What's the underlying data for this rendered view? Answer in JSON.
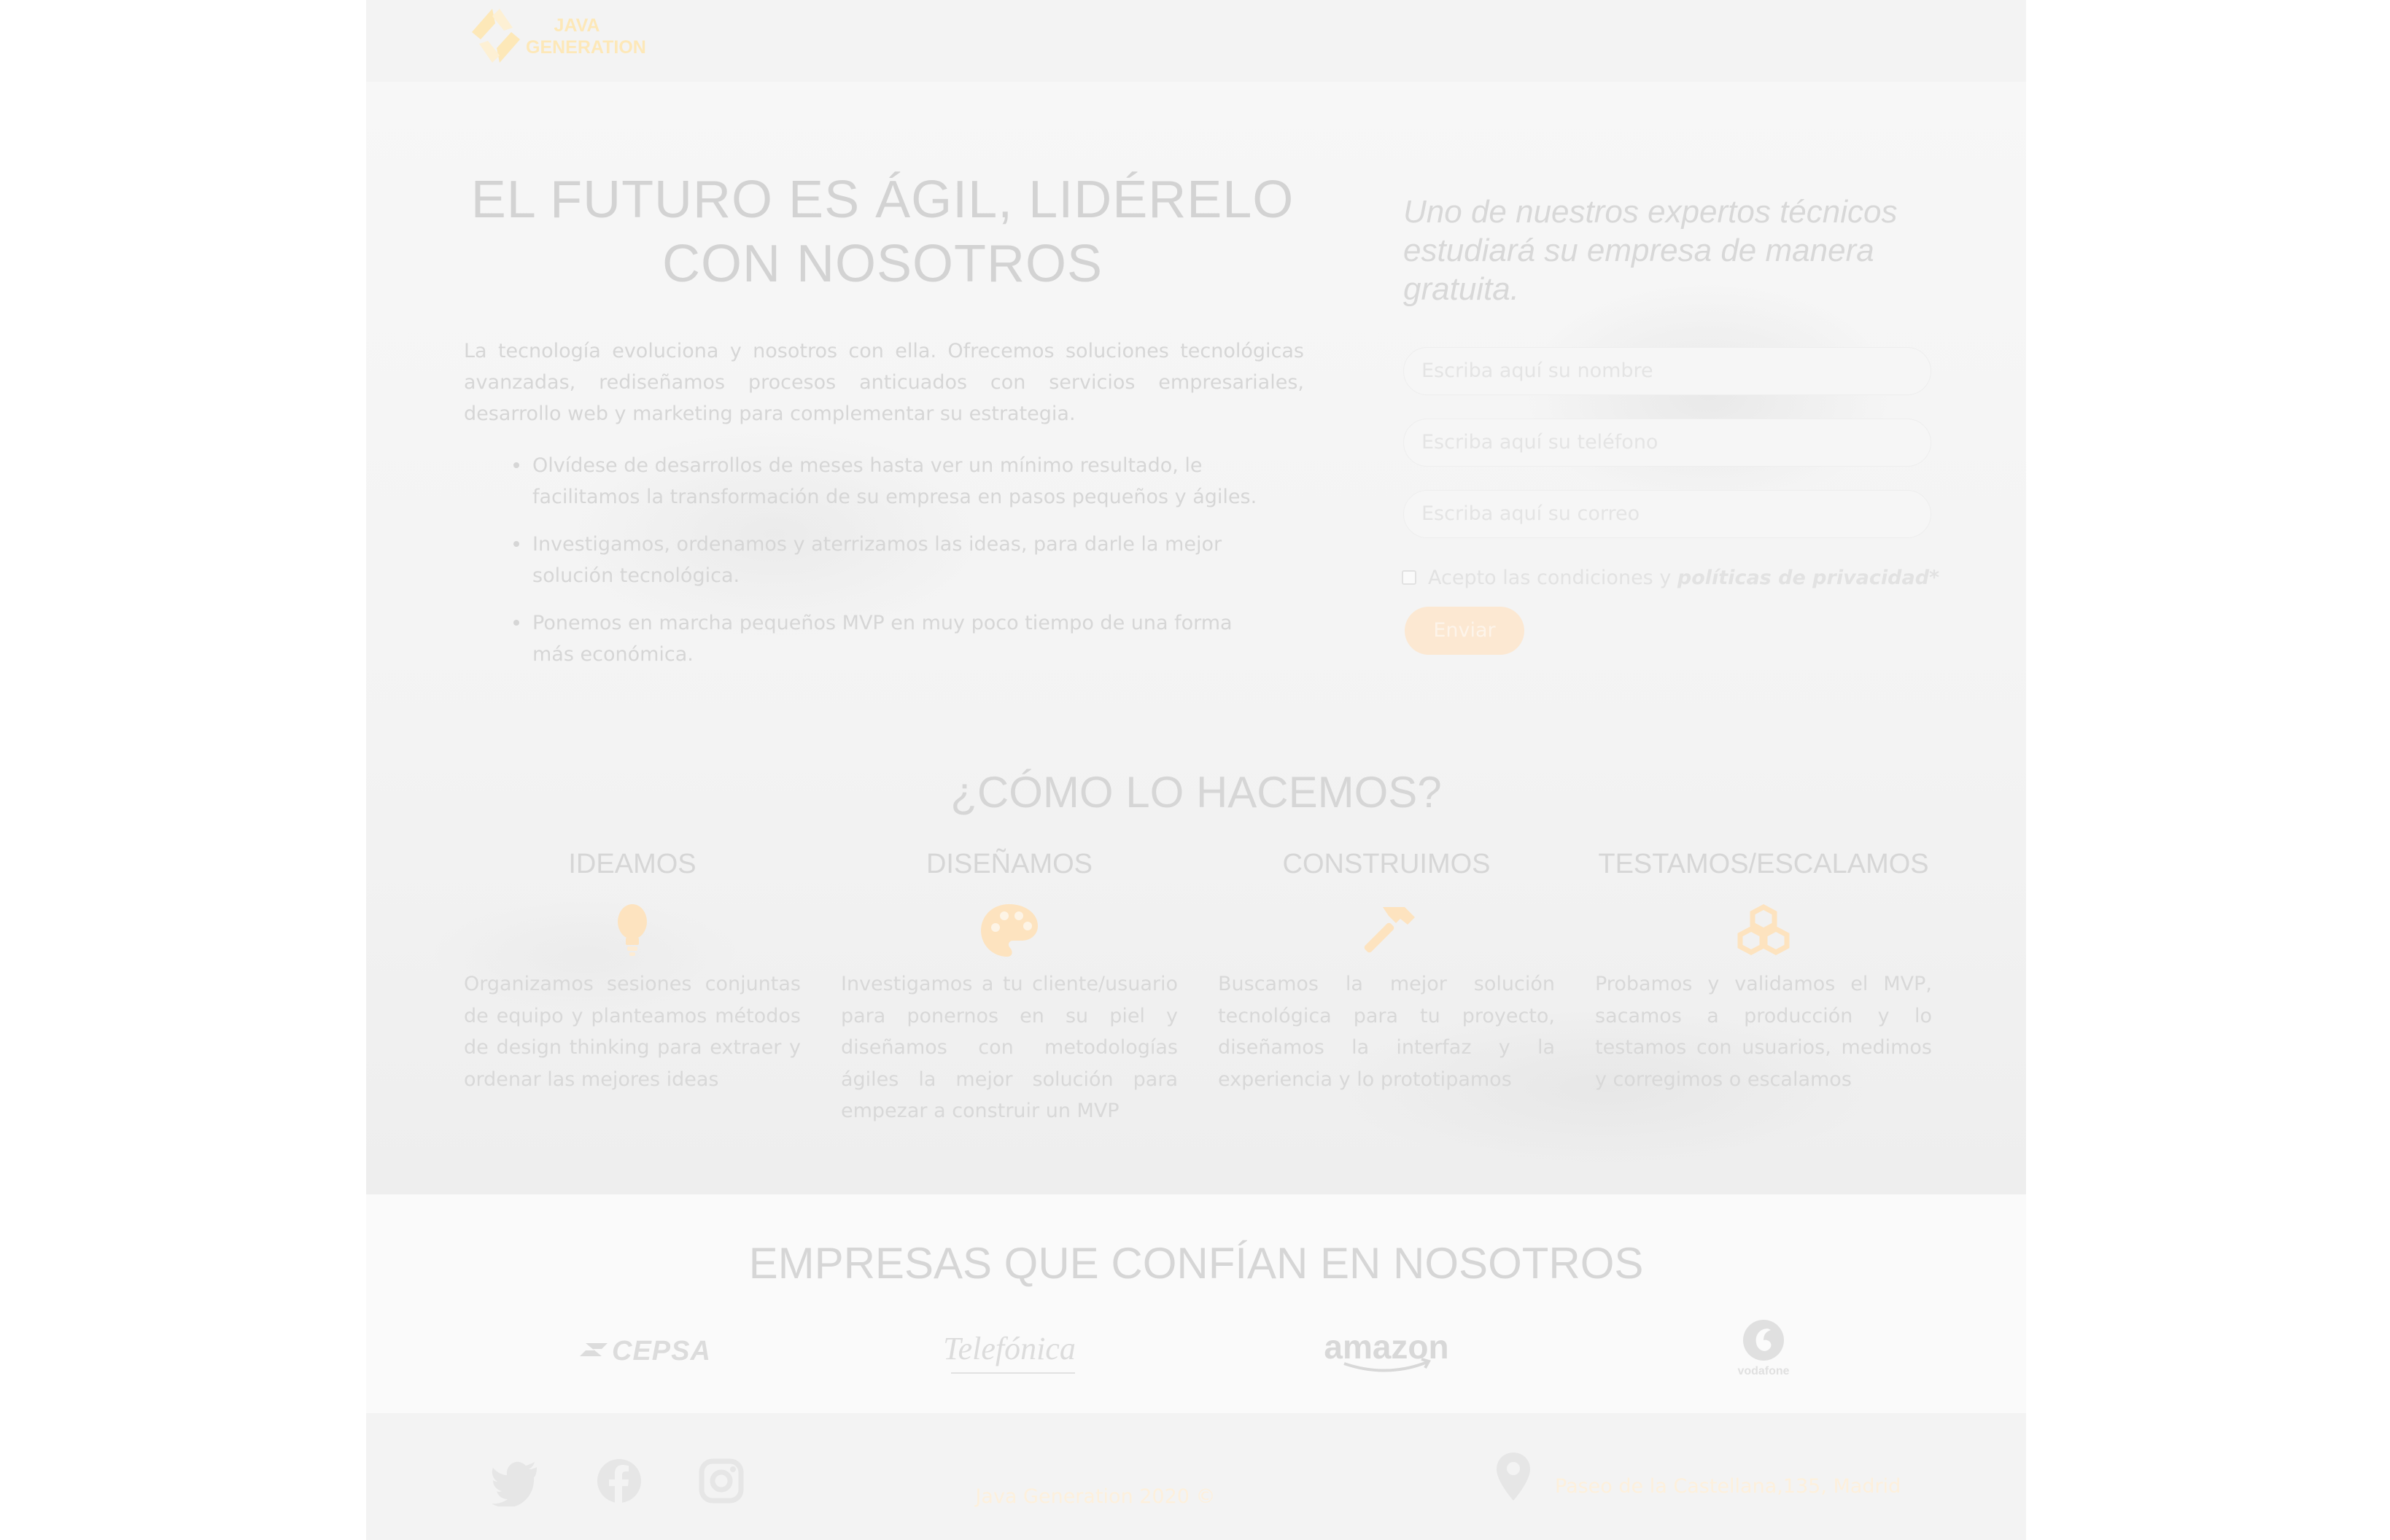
{
  "header": {
    "logo_line1": "JAVA",
    "logo_line2": "GENERATION"
  },
  "hero": {
    "title": "EL FUTURO ES ÁGIL, LIDÉRELO CON NOSOTROS",
    "intro": "La tecnología evoluciona y nosotros con ella. Ofrecemos soluciones tecnológicas avanzadas, rediseñamos procesos anticuados con servicios empresariales, desarrollo web y marketing para complementar su estrategia.",
    "bullets": [
      "Olvídese de desarrollos de meses hasta ver un mínimo resultado, le facilitamos la transformación de su empresa en pasos pequeños y ágiles.",
      "Investigamos, ordenamos y aterrizamos las ideas, para darle la mejor solución tecnológica.",
      "Ponemos en marcha pequeños MVP en muy poco tiempo de una forma más económica."
    ]
  },
  "form": {
    "title": "Uno de nuestros expertos técnicos estudiará su empresa de manera gratuita.",
    "name_placeholder": "Escriba aquí su nombre",
    "phone_placeholder": "Escriba aquí su teléfono",
    "email_placeholder": "Escriba aquí su correo",
    "accept_text": "Acepto las condiciones y ",
    "privacy_link": "políticas de privacidad*",
    "send_label": "Enviar"
  },
  "como": {
    "title": "¿CÓMO LO HACEMOS?",
    "steps": [
      {
        "title": "IDEAMOS",
        "icon": "lightbulb-icon",
        "text": "Organizamos sesiones conjuntas de equipo y planteamos métodos de design thinking para extraer y ordenar las mejores ideas"
      },
      {
        "title": "DISEÑAMOS",
        "icon": "palette-icon",
        "text": "Investigamos a tu cliente/usuario para ponernos en su piel y diseñamos con metodologías ágiles la mejor solución para empezar a construir un MVP"
      },
      {
        "title": "CONSTRUIMOS",
        "icon": "hammer-icon",
        "text": "Buscamos la mejor solución tecnológica para tu proyecto, diseñamos la interfaz y la experiencia y lo prototipamos"
      },
      {
        "title": "TESTAMOS/ESCALAMOS",
        "icon": "cubes-icon",
        "text": "Probamos y validamos el MVP, sacamos a producción y lo testamos con usuarios, medimos y corregimos o escalamos"
      }
    ]
  },
  "empresas": {
    "title": "EMPRESAS QUE CONFÍAN EN NOSOTROS",
    "brands": [
      "CEPSA",
      "Telefónica",
      "amazon",
      "vodafone"
    ]
  },
  "footer": {
    "copyright": "Java Generation 2020 ©",
    "address": "Paseo de la Castellana,135, Madrid",
    "social": [
      "twitter-icon",
      "facebook-icon",
      "instagram-icon"
    ]
  },
  "colors": {
    "accent": "#fce8d2",
    "icon_orange": "#fde3bf",
    "text": "#d6d6d6"
  }
}
